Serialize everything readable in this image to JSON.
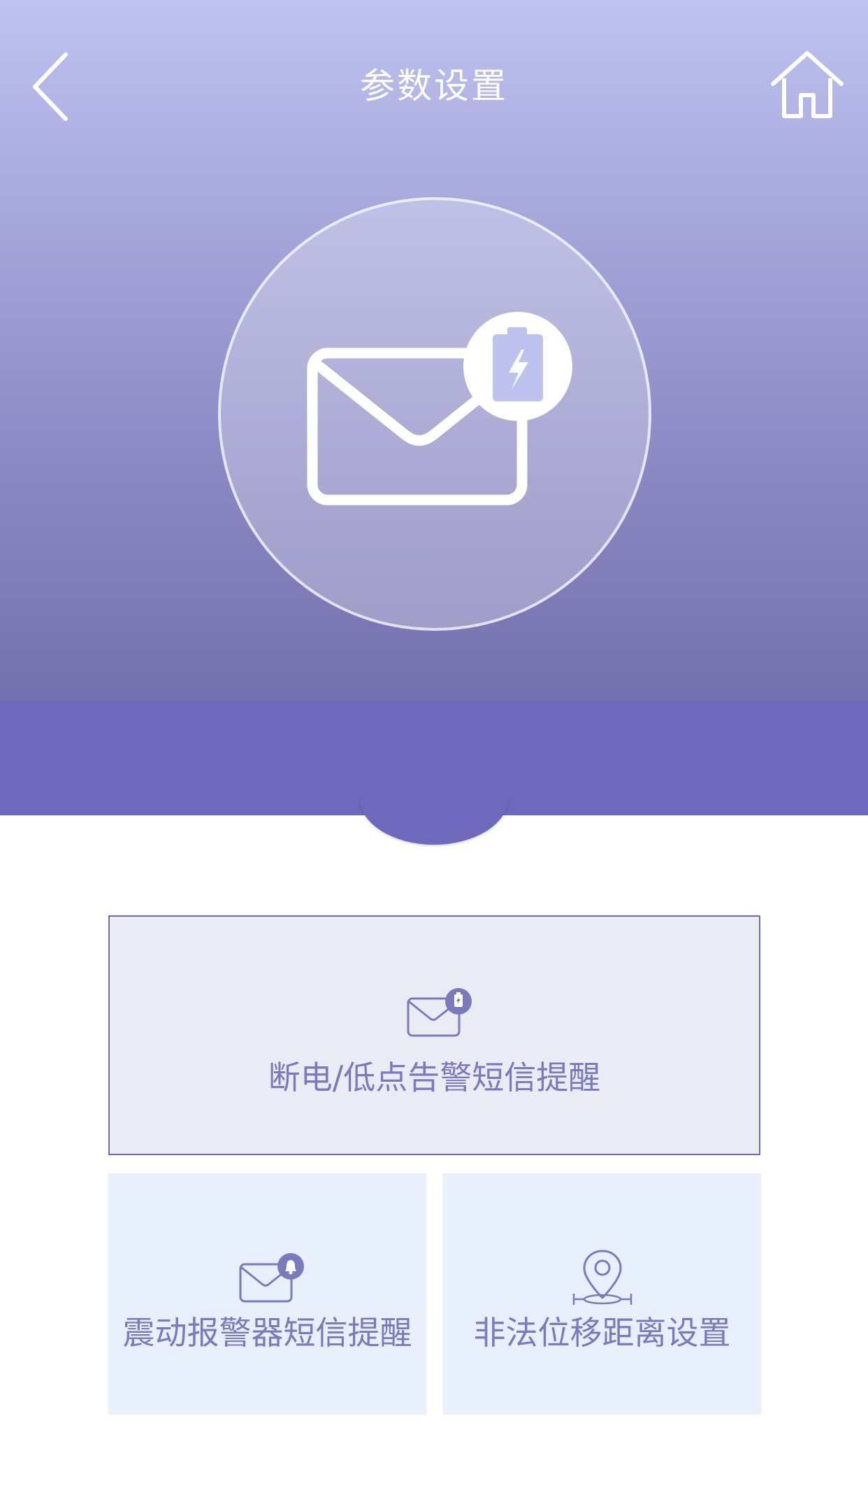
{
  "header": {
    "title": "参数设置",
    "back_icon": "chevron-left-icon",
    "home_icon": "home-icon"
  },
  "hero": {
    "icon": "mail-battery-icon"
  },
  "menu": {
    "power_alert": {
      "label": "断电/低点告警短信提醒",
      "icon": "mail-battery-icon"
    },
    "vibration_alert": {
      "label": "震动报警器短信提醒",
      "icon": "mail-bell-icon"
    },
    "displacement": {
      "label": "非法位移距离设置",
      "icon": "location-pin-icon"
    }
  },
  "colors": {
    "accent": "#6f69bd",
    "label": "#7b7aba",
    "card_light": "#ebebf6",
    "card_blue": "#e8f1fb"
  }
}
